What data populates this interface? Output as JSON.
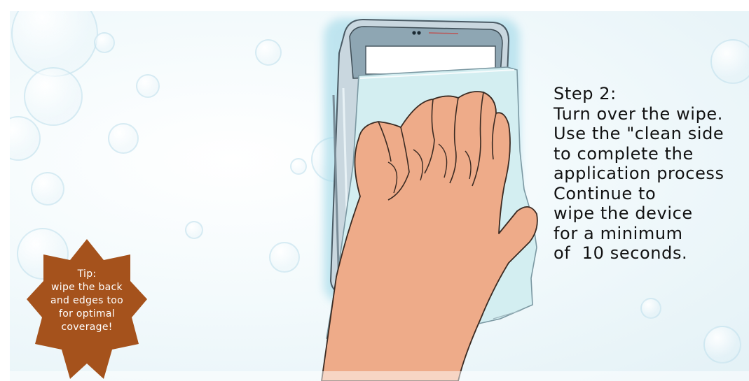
{
  "scene": {
    "illustration": "hand wiping smartphone with cleaning wipe",
    "background_color": "#eef7fa"
  },
  "caption": {
    "text": "Step 2:\nTurn over the wipe.\nUse the \"clean side\nto complete the\napplication process\nContinue to\nwipe the device\nfor a minimum\nof  10 seconds."
  },
  "tip_badge": {
    "text": "Tip:\nwipe the back\nand edges too\nfor optimal\ncoverage!",
    "color": "#a5521c"
  },
  "colors": {
    "skin": "#eeab89",
    "wipe": "#d6f0f3",
    "phone_glow": "#bfe6f0",
    "text": "#111111"
  }
}
